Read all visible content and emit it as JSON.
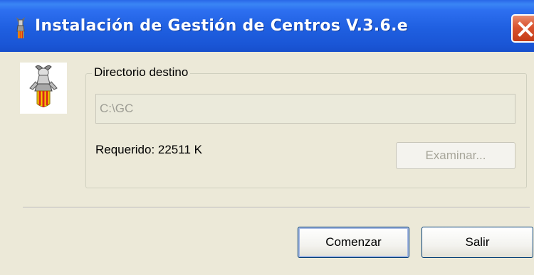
{
  "window": {
    "title": "Instalación de Gestión de Centros V.3.6.e",
    "close_icon": "close-icon",
    "title_icon": "app-crest-icon"
  },
  "destination": {
    "group_label": "Directorio destino",
    "path_value": "C:\\GC",
    "required_text": "Requerido: 22511 K",
    "browse_label": "Examinar..."
  },
  "actions": {
    "start_label": "Comenzar",
    "exit_label": "Salir"
  },
  "colors": {
    "titlebar": "#1f5fe0",
    "window_bg": "#ece9d8",
    "close_button": "#d9532f",
    "disabled_text": "#9d9d94"
  }
}
